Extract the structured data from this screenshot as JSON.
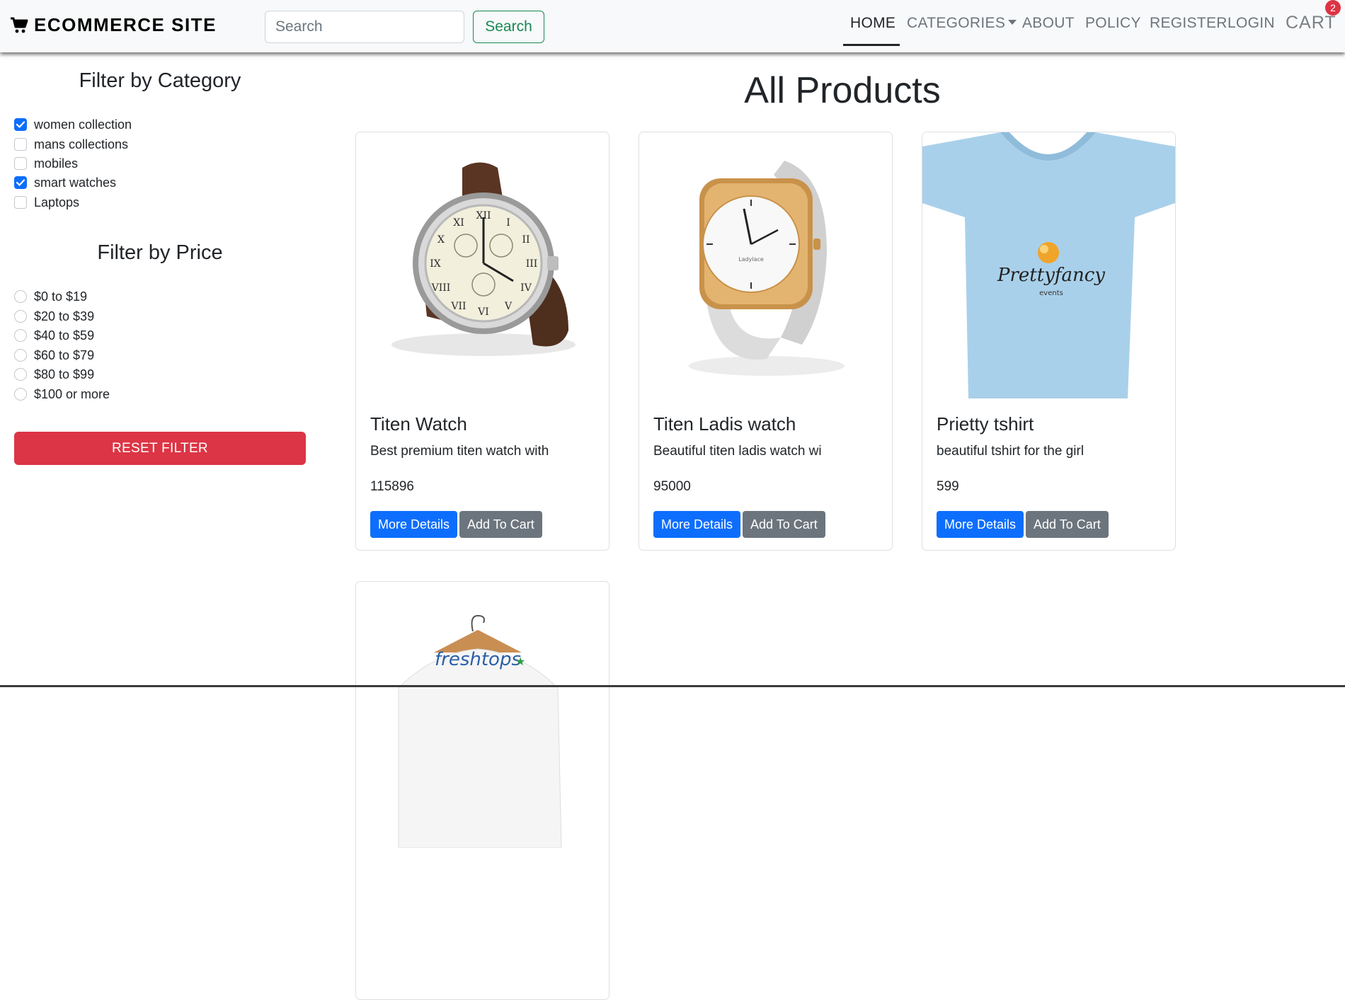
{
  "navbar": {
    "brand": "ECOMMERCE SITE",
    "search_placeholder": "Search",
    "search_button": "Search",
    "links": {
      "home": "HOME",
      "categories": "CATEGORIES",
      "about": "ABOUT",
      "policy": "POLICY",
      "register": "REGISTER",
      "login": "LOGIN",
      "cart": "CART"
    },
    "cart_count": "2",
    "active_link": "HOME"
  },
  "sidebar": {
    "category_title": "Filter by Category",
    "categories": [
      {
        "label": "women collection",
        "checked": true
      },
      {
        "label": "mans collections",
        "checked": false
      },
      {
        "label": "mobiles",
        "checked": false
      },
      {
        "label": "smart watches",
        "checked": true
      },
      {
        "label": "Laptops",
        "checked": false
      }
    ],
    "price_title": "Filter by Price",
    "prices": [
      {
        "label": "$0 to $19",
        "selected": false
      },
      {
        "label": "$20 to $39",
        "selected": false
      },
      {
        "label": "$40 to $59",
        "selected": false
      },
      {
        "label": "$60 to $79",
        "selected": false
      },
      {
        "label": "$80 to $99",
        "selected": false
      },
      {
        "label": "$100 or more",
        "selected": false
      }
    ],
    "reset_button": "RESET FILTER"
  },
  "main": {
    "title": "All Products",
    "products": [
      {
        "name": "Titen Watch",
        "description": "Best premium titen watch with",
        "price": "115896",
        "details_button": "More Details",
        "cart_button": "Add To Cart",
        "image": "leather-strap-watch"
      },
      {
        "name": "Titen Ladis watch",
        "description": "Beautiful titen ladis watch wi",
        "price": "95000",
        "details_button": "More Details",
        "cart_button": "Add To Cart",
        "image": "gold-ladies-watch"
      },
      {
        "name": "Prietty tshirt",
        "description": "beautiful tshirt for the girl",
        "price": "599",
        "details_button": "More Details",
        "cart_button": "Add To Cart",
        "image": "blue-tshirt",
        "image_text": "Prettyfancy",
        "image_subtext": "events"
      },
      {
        "name": "",
        "description": "",
        "price": "",
        "image": "white-shirt-on-hanger",
        "image_text": "freshtops"
      }
    ]
  },
  "colors": {
    "primary": "#0d6efd",
    "secondary": "#6c757d",
    "danger": "#dc3545",
    "success": "#198754",
    "navbar_bg": "#f8f9fa"
  }
}
